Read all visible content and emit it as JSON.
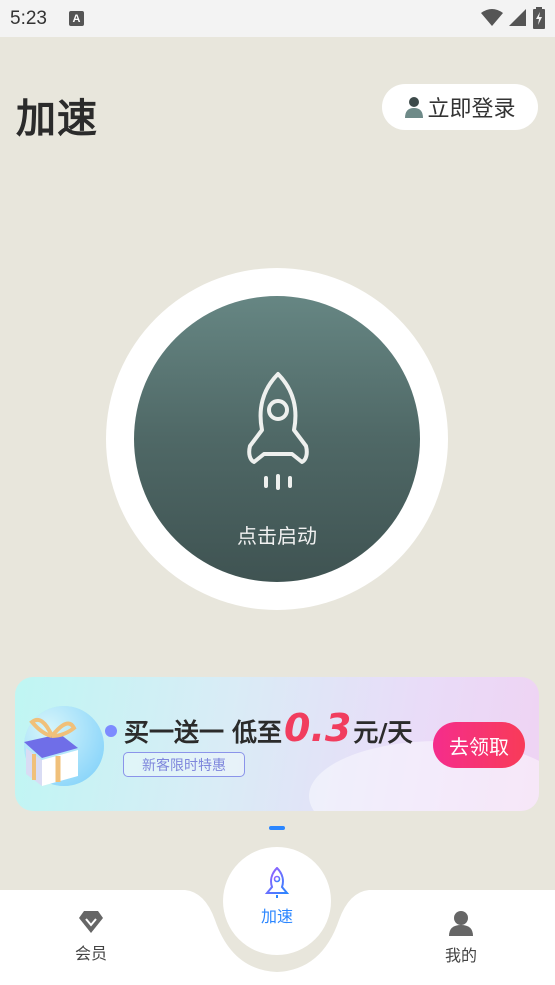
{
  "status_bar": {
    "time": "5:23",
    "notification_badge": "A"
  },
  "header": {
    "title": "加速",
    "login_label": "立即登录"
  },
  "start_button": {
    "label": "点击启动"
  },
  "banner": {
    "headline_part1": "买一送一",
    "headline_part2": "低至",
    "price": "0.3",
    "headline_unit": "元/天",
    "tag": "新客限时特惠",
    "claim_label": "去领取"
  },
  "bottom_nav": {
    "items": [
      {
        "label": "会员",
        "icon": "diamond-icon"
      },
      {
        "label": "加速",
        "icon": "rocket-icon",
        "active": true
      },
      {
        "label": "我的",
        "icon": "person-icon"
      }
    ]
  },
  "colors": {
    "background": "#e8e6dc",
    "start_gradient_top": "#668683",
    "start_gradient_bottom": "#3f5352",
    "price": "#f13d5e",
    "active_nav": "#2b86ff",
    "claim_button": "#f52d8c"
  }
}
